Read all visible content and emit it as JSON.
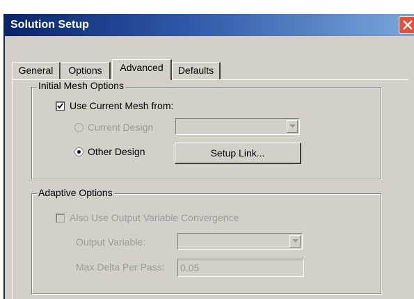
{
  "window": {
    "title": "Solution Setup"
  },
  "tabs": [
    {
      "label": "General",
      "active": false
    },
    {
      "label": "Options",
      "active": false
    },
    {
      "label": "Advanced",
      "active": true
    },
    {
      "label": "Defaults",
      "active": false
    }
  ],
  "initial_mesh": {
    "legend": "Initial Mesh Options",
    "use_current_mesh": {
      "label": "Use Current Mesh from:",
      "checked": true
    },
    "current_design": {
      "label": "Current Design",
      "selected": false,
      "enabled": false,
      "value": ""
    },
    "other_design": {
      "label": "Other Design",
      "selected": true
    },
    "setup_link_label": "Setup Link..."
  },
  "adaptive": {
    "legend": "Adaptive Options",
    "also_use": {
      "label": "Also Use Output Variable Convergence",
      "checked": false,
      "enabled": false
    },
    "output_variable": {
      "label": "Output Variable:",
      "value": ""
    },
    "max_delta": {
      "label": "Max Delta Per Pass:",
      "value": "0.05"
    }
  },
  "colors": {
    "title_bar": "#0a246a",
    "close_button": "#e0533a",
    "dialog_face": "#d4d0c8",
    "disabled_text": "#9a9a9a"
  },
  "icons": {
    "close": "close-icon",
    "check": "checkmark-icon",
    "dropdown": "chevron-down-icon"
  }
}
